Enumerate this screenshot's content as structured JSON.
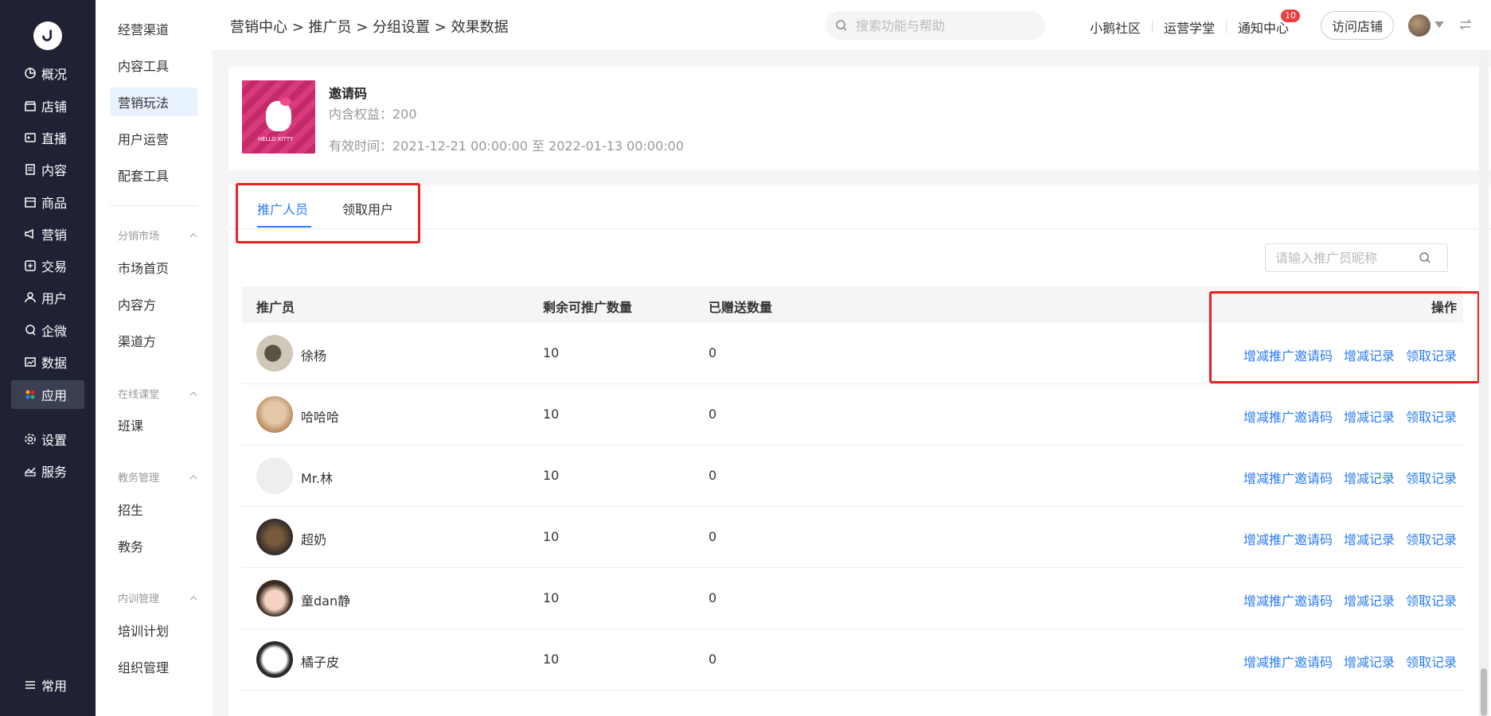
{
  "nav": {
    "items": [
      {
        "label": "概况",
        "icon": "pie-chart-icon"
      },
      {
        "label": "店铺",
        "icon": "store-icon"
      },
      {
        "label": "直播",
        "icon": "live-icon"
      },
      {
        "label": "内容",
        "icon": "document-icon"
      },
      {
        "label": "商品",
        "icon": "box-icon"
      },
      {
        "label": "营销",
        "icon": "megaphone-icon"
      },
      {
        "label": "交易",
        "icon": "trade-icon"
      },
      {
        "label": "用户",
        "icon": "user-icon"
      },
      {
        "label": "企微",
        "icon": "chat-icon"
      },
      {
        "label": "数据",
        "icon": "data-icon"
      },
      {
        "label": "应用",
        "icon": "apps-icon"
      },
      {
        "label": "设置",
        "icon": "gear-icon"
      },
      {
        "label": "服务",
        "icon": "service-icon"
      }
    ],
    "bottom_label": "常用"
  },
  "subnav": {
    "items_top": [
      "经营渠道",
      "内容工具",
      "营销玩法",
      "用户运营",
      "配套工具"
    ],
    "group1": {
      "title": "分销市场",
      "items": [
        "市场首页",
        "内容方",
        "渠道方"
      ]
    },
    "group2": {
      "title": "在线课堂",
      "items": [
        "班课"
      ]
    },
    "group3": {
      "title": "教务管理",
      "items": [
        "招生",
        "教务"
      ]
    },
    "group4": {
      "title": "内训管理",
      "items": [
        "培训计划",
        "组织管理"
      ]
    }
  },
  "header": {
    "breadcrumb": "营销中心 > 推广员 > 分组设置 > 效果数据",
    "search_placeholder": "搜索功能与帮助",
    "links": [
      "小鹅社区",
      "运营学堂",
      "通知中心"
    ],
    "badge": "10",
    "visit_label": "访问店铺"
  },
  "card": {
    "title": "邀请码",
    "benefit": "内含权益：200",
    "valid_time": "有效时间：2021-12-21 00:00:00 至 2022-01-13 00:00:00",
    "cover_text": "HELLO KITTY"
  },
  "tabs": [
    "推广人员",
    "领取用户"
  ],
  "filter_placeholder": "请输入推广员昵称",
  "table": {
    "headers": [
      "推广员",
      "剩余可推广数量",
      "已赠送数量",
      "操作"
    ],
    "ops": [
      "增减推广邀请码",
      "增减记录",
      "领取记录"
    ],
    "rows": [
      {
        "name": "徐杨",
        "remain": "10",
        "sent": "0"
      },
      {
        "name": "哈哈哈",
        "remain": "10",
        "sent": "0"
      },
      {
        "name": "Mr.林",
        "remain": "10",
        "sent": "0"
      },
      {
        "name": "超奶",
        "remain": "10",
        "sent": "0"
      },
      {
        "name": "童dan静",
        "remain": "10",
        "sent": "0"
      },
      {
        "name": "橘子皮",
        "remain": "10",
        "sent": "0"
      }
    ]
  },
  "colors": {
    "accent": "#2b7bf2",
    "sidebar": "#1f2234",
    "highlight": "#e8231f"
  }
}
